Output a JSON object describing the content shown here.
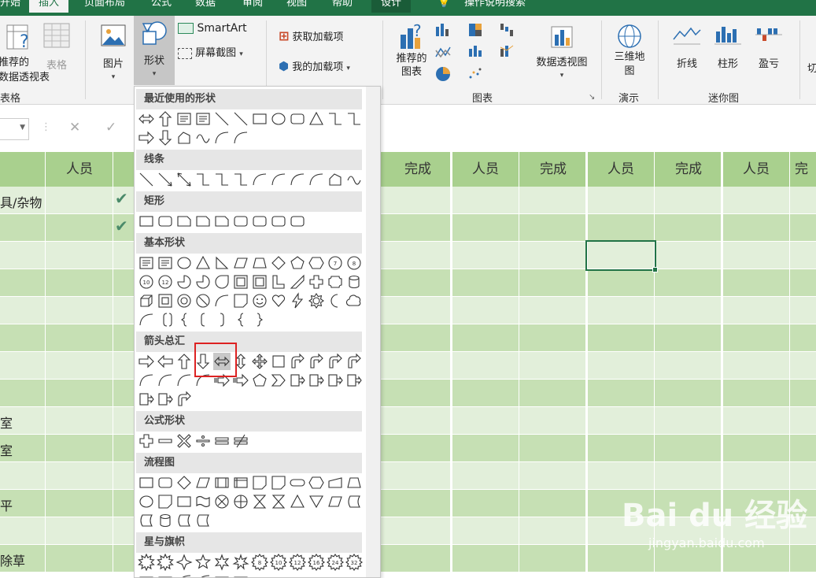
{
  "title_tabs": [
    "开始",
    "插入",
    "页面布局",
    "公式",
    "数据",
    "审阅",
    "视图",
    "帮助",
    "设计",
    "操作说明搜索"
  ],
  "ribbon": {
    "recommended_pivot": "推荐的\n数据透视表",
    "table": "表格",
    "tables_group": "表格",
    "picture": "图片",
    "shapes": "形状",
    "smartart": "SmartArt",
    "screenshot": "屏幕截图",
    "get_addins": "获取加载项",
    "my_addins": "我的加载项",
    "recommended_charts": "推荐的\n图表",
    "pivot_chart": "数据透视图",
    "charts_group": "图表",
    "map3d": "三维地\n图",
    "tours_group": "演示",
    "spark_line": "折线",
    "spark_column": "柱形",
    "spark_winloss": "盈亏",
    "sparklines_group": "迷你图",
    "slicer_partial": "切"
  },
  "formula_bar": {
    "cancel": "✕",
    "confirm": "✓"
  },
  "sheet": {
    "headers_left": [
      "人员"
    ],
    "headers_right": [
      "完成",
      "人员",
      "完成",
      "人员",
      "完成",
      "人员",
      "完"
    ],
    "rows": [
      "具/杂物",
      "",
      "",
      "",
      "",
      "",
      "",
      "",
      "室",
      "室",
      "",
      "平",
      "",
      "除草"
    ],
    "checked_rows": [
      0,
      1
    ]
  },
  "shapes_menu": {
    "categories": [
      {
        "label": "最近使用的形状",
        "icons": [
          "left-right-arrow",
          "up-arrow",
          "text-box",
          "vertical-text-box",
          "line",
          "line",
          "rectangle",
          "oval",
          "rounded-rectangle",
          "triangle",
          "elbow-connector",
          "elbow-arrow-connector",
          "right-arrow",
          "down-arrow",
          "freeform",
          "scribble",
          "arc",
          "curve"
        ]
      },
      {
        "label": "线条",
        "icons": [
          "line",
          "line-arrow",
          "line-double-arrow",
          "elbow-connector",
          "elbow-arrow-connector",
          "elbow-double-arrow",
          "curved-connector",
          "curved-arrow-connector",
          "curved-double-arrow",
          "curve",
          "freeform",
          "scribble"
        ]
      },
      {
        "label": "矩形",
        "icons": [
          "rectangle",
          "rounded-rectangle",
          "snip-corner-rect",
          "snip-two-corner-rect",
          "snip-diagonal-rect",
          "round-snip-rect",
          "round-corner-rect",
          "round-two-corner-rect",
          "round-diagonal-rect"
        ]
      },
      {
        "label": "基本形状",
        "icons": [
          "text-box",
          "vertical-text-box",
          "oval",
          "isosceles-triangle",
          "right-triangle",
          "parallelogram",
          "trapezoid",
          "diamond",
          "pentagon",
          "hexagon",
          "heptagon",
          "octagon",
          "decagon",
          "dodecagon",
          "pie",
          "chord",
          "teardrop",
          "frame",
          "half-frame",
          "l-shape",
          "diagonal-stripe",
          "cross",
          "plaque",
          "can",
          "cube",
          "bevel",
          "donut",
          "no-symbol",
          "block-arc",
          "folded-corner",
          "smiley-face",
          "heart",
          "lightning-bolt",
          "sun",
          "moon",
          "cloud",
          "arc",
          "double-bracket",
          "double-brace",
          "left-bracket",
          "right-bracket",
          "left-brace",
          "right-brace"
        ]
      },
      {
        "label": "箭头总汇",
        "icons": [
          "right-arrow",
          "left-arrow",
          "up-arrow",
          "down-arrow",
          "left-right-arrow",
          "up-down-arrow",
          "quad-arrow",
          "left-right-up-arrow",
          "bent-arrow",
          "u-turn-arrow",
          "left-up-arrow",
          "bent-up-arrow",
          "curved-right-arrow",
          "curved-left-arrow",
          "curved-up-arrow",
          "curved-down-arrow",
          "striped-right-arrow",
          "notched-right-arrow",
          "pentagon-arrow",
          "chevron",
          "right-arrow-callout",
          "down-arrow-callout",
          "left-arrow-callout",
          "up-arrow-callout",
          "left-right-arrow-callout",
          "quad-arrow-callout",
          "circular-arrow"
        ]
      },
      {
        "label": "公式形状",
        "icons": [
          "plus",
          "minus",
          "multiply",
          "divide",
          "equal",
          "not-equal"
        ]
      },
      {
        "label": "流程图",
        "icons": [
          "process",
          "alternate-process",
          "decision",
          "data",
          "predefined-process",
          "internal-storage",
          "document",
          "multidocument",
          "terminator",
          "preparation",
          "manual-input",
          "manual-operation",
          "connector",
          "off-page-connector",
          "card",
          "punched-tape",
          "summing-junction",
          "or",
          "collate",
          "sort",
          "extract",
          "merge",
          "stored-data",
          "delay",
          "sequential-access-storage",
          "magnetic-disk",
          "direct-access-storage",
          "display"
        ]
      },
      {
        "label": "星与旗帜",
        "icons": [
          "explosion-1",
          "explosion-2",
          "star-4",
          "star-5",
          "star-6",
          "star-7",
          "star-8",
          "star-10",
          "star-12",
          "star-16",
          "star-24",
          "star-32",
          "ribbon-up",
          "ribbon-down",
          "curved-ribbon-up",
          "curved-ribbon-down",
          "vertical-scroll",
          "horizontal-scroll",
          "wave"
        ]
      }
    ],
    "star_numbers": {
      "star-8": "8",
      "star-10": "10",
      "star-12": "12",
      "star-16": "16",
      "star-24": "24",
      "star-32": "32",
      "decagon": "10",
      "dodecagon": "12",
      "heptagon": "7",
      "octagon": "8"
    },
    "highlighted_icon": "left-right-arrow",
    "highlight_color": "#dd2222"
  },
  "watermark": {
    "brand": "Bai du 经验",
    "url": "jingyan.baidu.com"
  },
  "colors": {
    "accent": "#217346",
    "header_green": "#a9d08e",
    "row_light": "#e2efda",
    "row_dark": "#c6e0b4"
  }
}
